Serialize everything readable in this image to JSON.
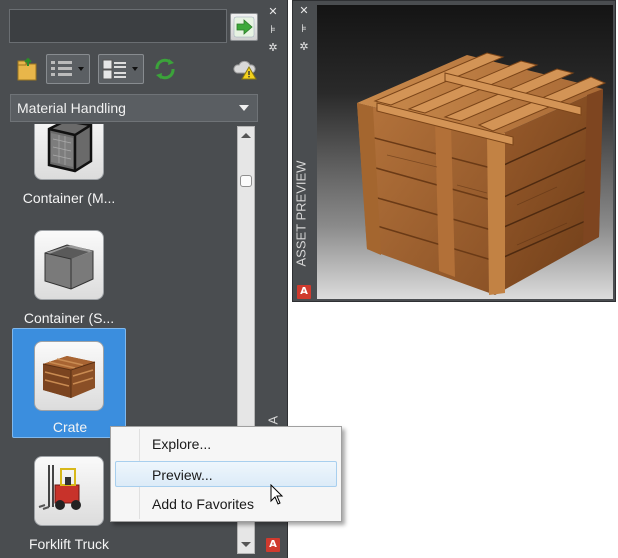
{
  "search": {
    "value": "",
    "placeholder": ""
  },
  "toolbar": {
    "icons": [
      "folder-open-icon",
      "list-view-icon",
      "details-view-icon",
      "refresh-icon",
      "cloud-warning-icon"
    ]
  },
  "category": {
    "selected": "Material Handling"
  },
  "assets": [
    {
      "label": "Container (M...",
      "icon": "mesh-container-icon"
    },
    {
      "label": "Container (S...",
      "icon": "solid-container-icon"
    },
    {
      "label": "Crate",
      "icon": "crate-icon",
      "selected": true
    },
    {
      "label": "Forklift Truck",
      "icon": "forklift-icon"
    }
  ],
  "palette": {
    "browser_title_partial": "A",
    "preview_title": "ASSET PREVIEW"
  },
  "context_menu": {
    "items": [
      "Explore...",
      "Preview...",
      "Add to Favorites"
    ],
    "hovered": "Preview..."
  },
  "colors": {
    "selection": "#3b8ede",
    "panel": "#4a4d50",
    "menu_hover": "#dcebf8"
  }
}
